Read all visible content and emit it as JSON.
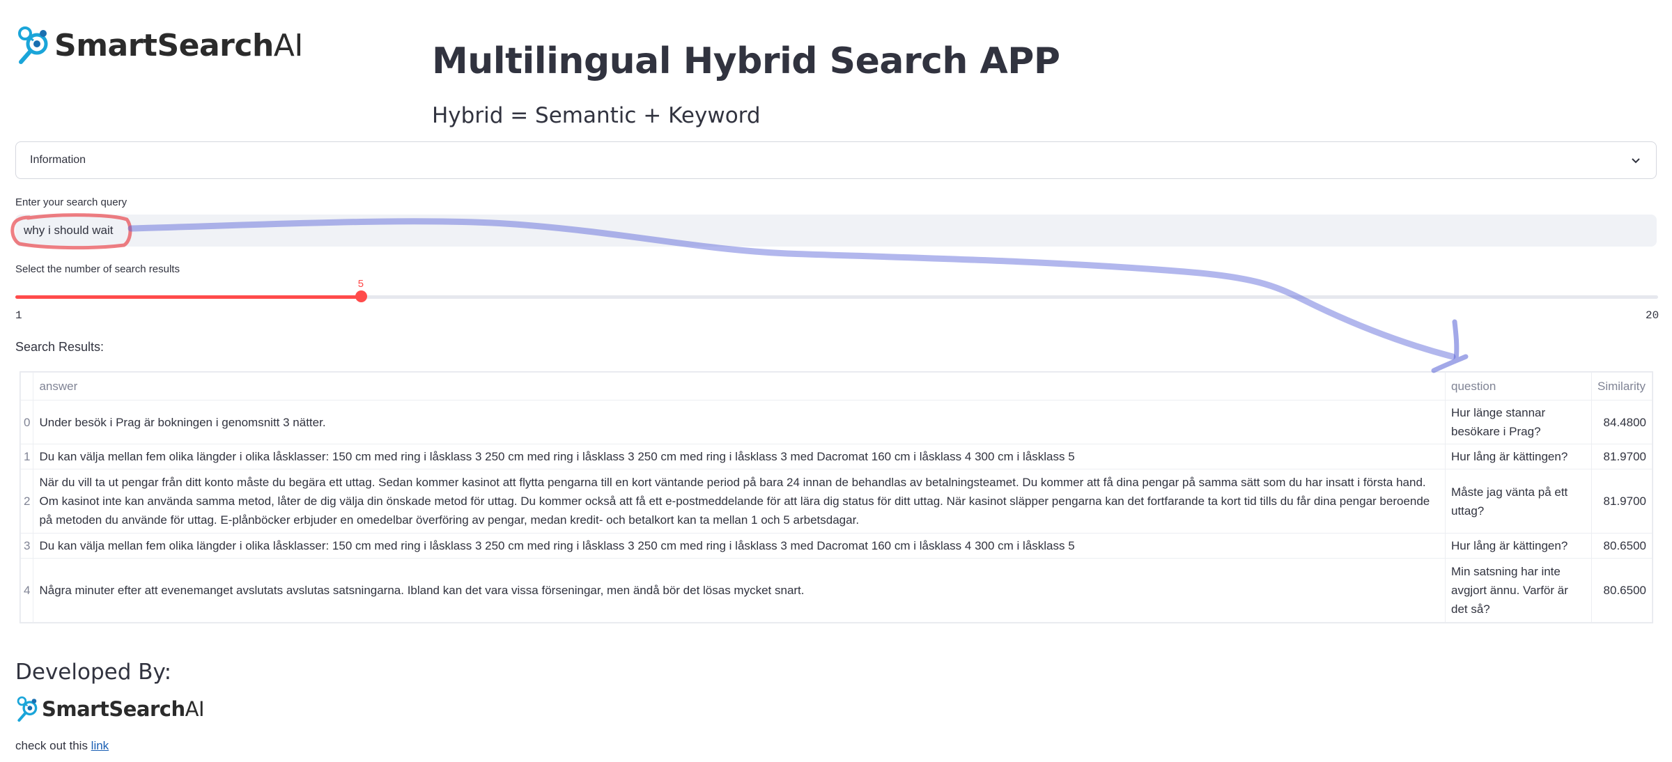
{
  "brand": {
    "name_bold": "SmartSearch",
    "name_light": "AI",
    "colors": {
      "primary": "#1aa5d9",
      "text": "#2b2b2b"
    }
  },
  "header": {
    "title": "Multilingual Hybrid Search APP",
    "subtitle": "Hybrid = Semantic + Keyword"
  },
  "expander": {
    "label": "Information",
    "icon": "chevron-down-icon"
  },
  "search": {
    "label": "Enter your search query",
    "value": "why i should wait"
  },
  "slider": {
    "label": "Select the number of search results",
    "value": "5",
    "min": "1",
    "max": "20",
    "accent": "#ff4b4b"
  },
  "results": {
    "label": "Search Results:",
    "columns": [
      "answer",
      "question",
      "Similarity"
    ],
    "rows": [
      {
        "index": "0",
        "answer": "Under besök i Prag är bokningen i genomsnitt 3 nätter.",
        "question": "Hur länge stannar besökare i Prag?",
        "similarity": "84.4800"
      },
      {
        "index": "1",
        "answer": "Du kan välja mellan fem olika längder i olika låsklasser:  150 cm med ring i låsklass 3 250 cm med ring i låsklass 3 250 cm med ring i låsklass 3 med Dacromat 160 cm i låsklass 4 300 cm i låsklass 5",
        "question": "Hur lång är kättingen?",
        "similarity": "81.9700"
      },
      {
        "index": "2",
        "answer": "När du vill ta ut pengar från ditt konto måste du begära ett uttag. Sedan kommer kasinot att flytta pengarna till en kort väntande period på bara 24 innan de behandlas av betalningsteamet. Du kommer att få dina pengar på samma sätt som du har insatt i första hand. Om kasinot inte kan använda samma metod, låter de dig välja din önskade metod för uttag. Du kommer också att få ett e-postmeddelande för att lära dig status för ditt uttag. När kasinot släpper pengarna kan det fortfarande ta kort tid tills du får dina pengar beroende på metoden du använde för uttag. E-plånböcker erbjuder en omedelbar överföring av pengar, medan kredit- och betalkort kan ta mellan 1 och 5 arbetsdagar.",
        "question": "Måste jag vänta på ett uttag?",
        "similarity": "81.9700"
      },
      {
        "index": "3",
        "answer": "Du kan välja mellan fem olika längder i olika låsklasser:  150 cm med ring i låsklass 3 250 cm med ring i låsklass 3 250 cm med ring i låsklass 3 med Dacromat 160 cm i låsklass 4 300 cm i låsklass 5",
        "question": "Hur lång är kättingen?",
        "similarity": "80.6500"
      },
      {
        "index": "4",
        "answer": "Några minuter efter att evenemanget avslutats avslutas satsningarna. Ibland kan det vara vissa förseningar, men ändå bör det lösas mycket snart.",
        "question": "Min satsning har inte avgjort ännu. Varför är det så?",
        "similarity": "80.6500"
      }
    ]
  },
  "footer": {
    "developed_by": "Developed By:",
    "checkout_text": "check out this ",
    "link_text": "link"
  },
  "annotations": {
    "highlight_color": "#e8484f",
    "arrow_color": "#5560d6"
  }
}
